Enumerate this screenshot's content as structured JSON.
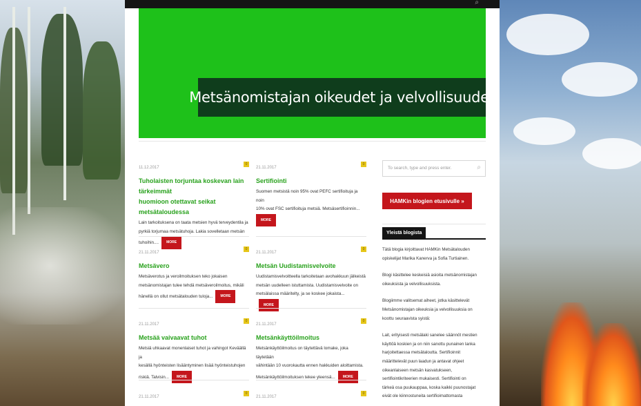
{
  "hero": {
    "title": "Metsänomistajan oikeudet ja velvollisuudet"
  },
  "posts": [
    {
      "date": "11.12.2017",
      "comments": "0",
      "title_lines": [
        "Tuholaisten torjuntaa koskevan lain tärkeimmät",
        "huomioon otettavat seikat metsätaloudessa"
      ],
      "excerpt_lines": [
        "Lain tarkoituksena on taata metsien hyvä terveydentila ja",
        "pyrkiä torjumaa metsätuhoja. Lakia sovelletaan metsän",
        "tuhoihin...."
      ],
      "more": "MORE"
    },
    {
      "date": "21.11.2017",
      "comments": "0",
      "title_lines": [
        "Sertifiointi"
      ],
      "excerpt_lines": [
        "Suomen metsistä noin 95% ovat PEFC sertifioituja ja noin",
        "10% ovat FSC sertifioituja metsiä. Metsäsertifioinnin..."
      ],
      "more": "MORE"
    },
    {
      "date": "21.11.2017",
      "comments": "0",
      "title_lines": [
        "Metsävero"
      ],
      "excerpt_lines": [
        "Metsäverotus ja veroilmoituksen teko jokaisen",
        "metsänomistajan tulee tehdä metsäveroilmoitus, mikäli",
        "hänellä on ollut metsätalouden tuloja..."
      ],
      "more": "MORE"
    },
    {
      "date": "21.11.2017",
      "comments": "0",
      "title_lines": [
        "Metsän Uudistamisvelvoite"
      ],
      "excerpt_lines": [
        "Uudistamisvelvoitteella tarkoitetaan avohakkuun jälkeistä",
        "metsän uudelleen istuttamista. Uudistamisvelvoite on",
        "metsälaissa määritelty, ja se koskee jokaista..."
      ],
      "more": "MORE"
    },
    {
      "date": "21.11.2017",
      "comments": "0",
      "title_lines": [
        "Metsää vaivaavat tuhot"
      ],
      "excerpt_lines": [
        "Metsiä uhkaavat monenlaiset tuhot ja vahingot Keväällä ja",
        "kesällä hyönteisten lisääntyminen lisää hyönteistuhojen",
        "riskiä. Talvisin..."
      ],
      "more": "MORE"
    },
    {
      "date": "21.11.2017",
      "comments": "0",
      "title_lines": [
        "Metsänkäyttöilmoitus"
      ],
      "excerpt_lines": [
        "Metsänkäyttöilmoitus on täytettävä lomake, joka täytetään",
        "vähintään 10 vuorokautta ennen hakkuiden aloittamista.",
        "Metsänkäyttöilmoituksen tekee yleensä..."
      ],
      "more": "MORE"
    },
    {
      "date": "21.11.2017",
      "comments": "0"
    },
    {
      "date": "21.11.2017",
      "comments": "0"
    }
  ],
  "sidebar": {
    "search_placeholder": "To search, type and press enter.",
    "home_button": "HAMKin blogien etusivulle »",
    "about_heading": "Yleistä blogista",
    "about_paragraphs": [
      [
        "Tätä blogia kirjoittavat HAMKin Metsätalouden",
        "opiskelijat Marika Kanerva ja Sofia Turtiainen."
      ],
      [
        "Blogi käsittelee keskeisiä asioita metsänomistajan",
        "oikeuksista ja velvollisuuksista."
      ],
      [
        "Blogiimme valitsemat aiheet, jotka käsittelevät",
        "Metsänomistajan oikeuksia ja velvollisuuksia on",
        "koottu seuraavista syistä:"
      ],
      [
        "Lait, erityisesti metsälaki sanelee säännöt mestien",
        "käyttöä koskien ja on niin sanottu punainen lanka",
        "harjoitettaessa metsätaloutta. Sertifioinnit",
        "määrittelevät puun laadun ja antavat ohjeet",
        "oikeanlaiseen metsän kasvatukseen,",
        "sertifiointikriteerien mukaisesti. Sertifiointi on",
        "tärkeä osa puukauppaa, koska kaikki puunostajat",
        "eivät ole kiinnostuneita sertifioimattomasta"
      ]
    ]
  },
  "colors": {
    "hero_green": "#1ec11a",
    "title_box": "#0f3d1c",
    "post_title": "#2aa21e",
    "more_red": "#c4161c"
  }
}
